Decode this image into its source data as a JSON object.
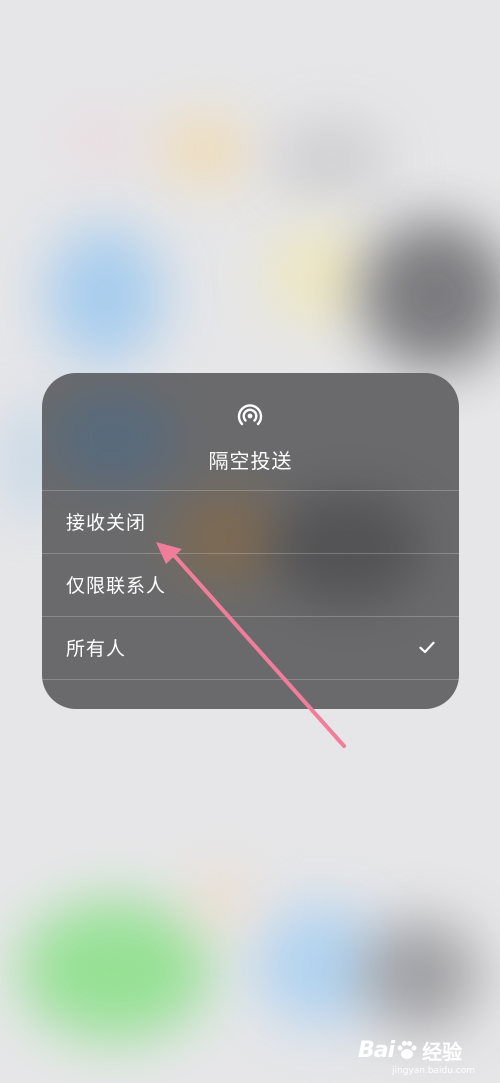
{
  "airdrop_menu": {
    "icon": "airdrop-icon",
    "title": "隔空投送",
    "options": [
      {
        "label": "接收关闭",
        "selected": false
      },
      {
        "label": "仅限联系人",
        "selected": false
      },
      {
        "label": "所有人",
        "selected": true
      }
    ],
    "check_icon": "checkmark-icon"
  },
  "annotation": {
    "type": "arrow",
    "color": "#f07d9a",
    "points_to": "接收关闭"
  },
  "watermark": {
    "brand": "Bai",
    "brand_suffix": "经验",
    "url": "jingyan.baidu.com"
  }
}
